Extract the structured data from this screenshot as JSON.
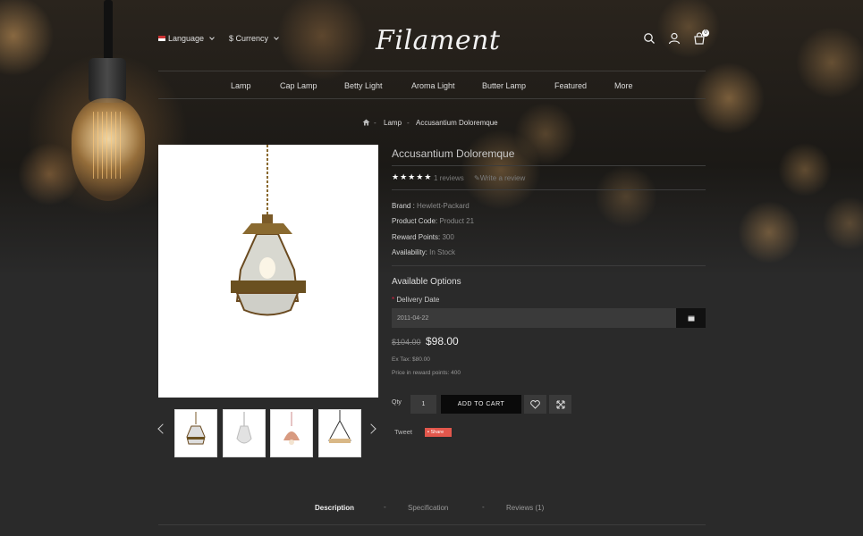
{
  "header": {
    "language_label": "Language",
    "currency_label": "$ Currency",
    "logo_text": "Filament",
    "cart_count": "0"
  },
  "nav": {
    "items": [
      "Lamp",
      "Cap Lamp",
      "Betty Light",
      "Aroma Light",
      "Butter Lamp",
      "Featured",
      "More"
    ]
  },
  "breadcrumb": {
    "items": [
      "Lamp",
      "Accusantium Doloremque"
    ],
    "separator": "-"
  },
  "product": {
    "title": "Accusantium Doloremque",
    "rating": 5,
    "stars": "★★★★★",
    "reviews_link": "1 reviews",
    "write_review": "Write a review",
    "brand_label": "Brand :",
    "brand_value": "Hewlett-Packard",
    "code_label": "Product Code:",
    "code_value": "Product 21",
    "points_label": "Reward Points:",
    "points_value": "300",
    "availability_label": "Availability:",
    "availability_value": "In Stock",
    "options_title": "Available Options",
    "required_mark": "*",
    "delivery_label": "Delivery Date",
    "delivery_value": "2011-04-22",
    "old_price": "$104.00",
    "new_price": "$98.00",
    "ex_tax": "Ex Tax: $80.00",
    "reward_price": "Price in reward points: 400",
    "qty_label": "Qty",
    "qty_value": "1",
    "add_to_cart": "ADD TO CART",
    "tweet": "Tweet",
    "share": "Share"
  },
  "tabs": {
    "items": [
      "Description",
      "Specification",
      "Reviews (1)"
    ],
    "separator": "-"
  },
  "colors": {
    "background": "#2a2a2a",
    "button_dark": "#0a0a0a",
    "share": "#e2574c",
    "required": "#dd2244"
  }
}
